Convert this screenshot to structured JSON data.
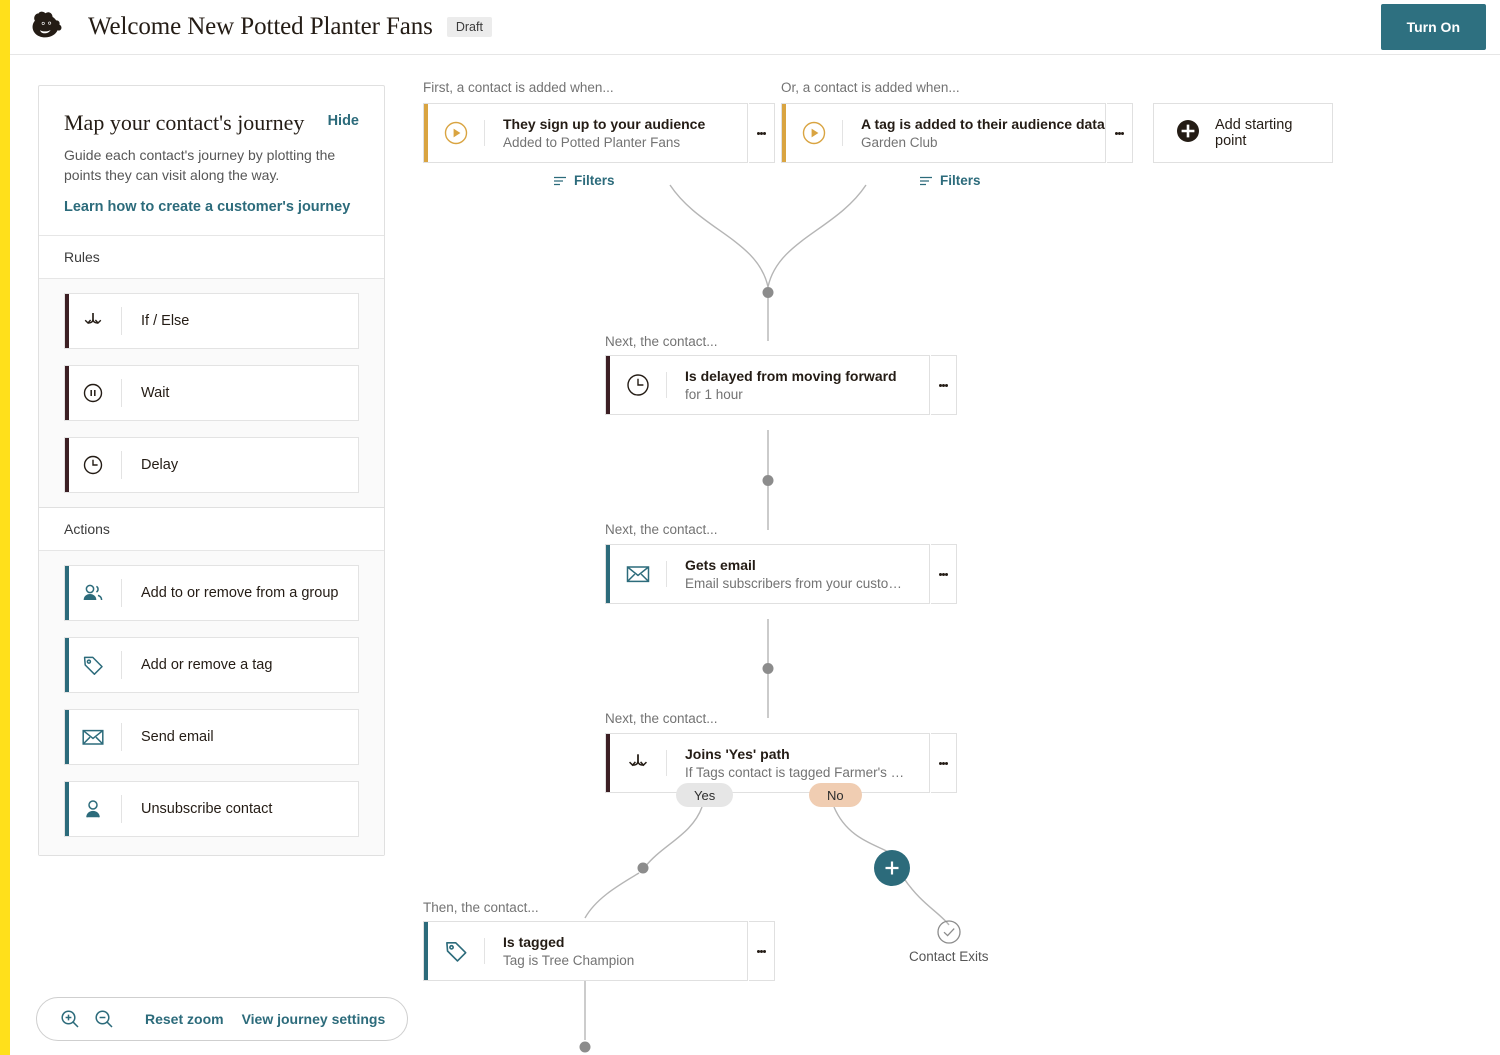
{
  "header": {
    "logo_icon": "mailchimp-freddie-logo",
    "title": "Welcome New Potted Planter Fans",
    "status_badge": "Draft",
    "turn_on_label": "Turn On"
  },
  "sidebar": {
    "title": "Map your contact's journey",
    "hide_label": "Hide",
    "description": "Guide each contact's journey by plotting the points they can visit along the way.",
    "learn_link": "Learn how to create a customer's journey",
    "sections": [
      {
        "heading": "Rules",
        "items": [
          {
            "label": "If / Else",
            "icon": "branch-icon"
          },
          {
            "label": "Wait",
            "icon": "pause-circle-icon"
          },
          {
            "label": "Delay",
            "icon": "clock-icon"
          }
        ]
      },
      {
        "heading": "Actions",
        "items": [
          {
            "label": "Add to or remove from a group",
            "icon": "group-people-icon"
          },
          {
            "label": "Add or remove a tag",
            "icon": "tag-icon"
          },
          {
            "label": "Send email",
            "icon": "envelope-icon"
          },
          {
            "label": "Unsubscribe contact",
            "icon": "person-icon"
          }
        ]
      }
    ]
  },
  "zoom_toolbar": {
    "zoom_in_icon": "magnifier-plus-icon",
    "zoom_out_icon": "magnifier-minus-icon",
    "reset_label": "Reset zoom",
    "settings_label": "View journey settings"
  },
  "canvas": {
    "captions": {
      "first_trigger": "First, a contact is added when...",
      "or_trigger": "Or, a contact is added when...",
      "next_1": "Next, the contact...",
      "next_2": "Next, the contact...",
      "next_3": "Next, the contact...",
      "then_1": "Then, the contact..."
    },
    "filters_label": "Filters",
    "add_starting_point": "Add starting point",
    "triggers": [
      {
        "title": "They sign up to your audience",
        "subtitle": "Added to Potted Planter Fans",
        "icon": "play-circle-icon"
      },
      {
        "title": "A tag is added to their audience data",
        "subtitle": "Garden Club",
        "icon": "play-circle-icon"
      }
    ],
    "steps": [
      {
        "title": "Is delayed from moving forward",
        "subtitle": "for 1 hour",
        "icon": "clock-icon",
        "kind": "rule"
      },
      {
        "title": "Gets email",
        "subtitle": "Email subscribers from your customer j...",
        "icon": "envelope-icon",
        "kind": "action"
      },
      {
        "title": "Joins 'Yes' path",
        "subtitle": "If Tags contact is tagged Farmer's Market",
        "icon": "branch-icon",
        "kind": "rule"
      },
      {
        "title": "Is tagged",
        "subtitle": "Tag is Tree Champion",
        "icon": "tag-icon",
        "kind": "action"
      }
    ],
    "branches": {
      "yes": "Yes",
      "no": "No"
    },
    "exit_label": "Contact Exits",
    "add_step_icon": "plus-circle-icon",
    "exit_icon": "check-circle-icon"
  },
  "colors": {
    "brand_yellow": "#ffe01b",
    "teal": "#2c6b7b",
    "trigger_gold": "#d9a441",
    "rule_maroon": "#3c1f24",
    "chip_no_peach": "#f0cdb2",
    "chip_yes_gray": "#e6e6e6"
  }
}
